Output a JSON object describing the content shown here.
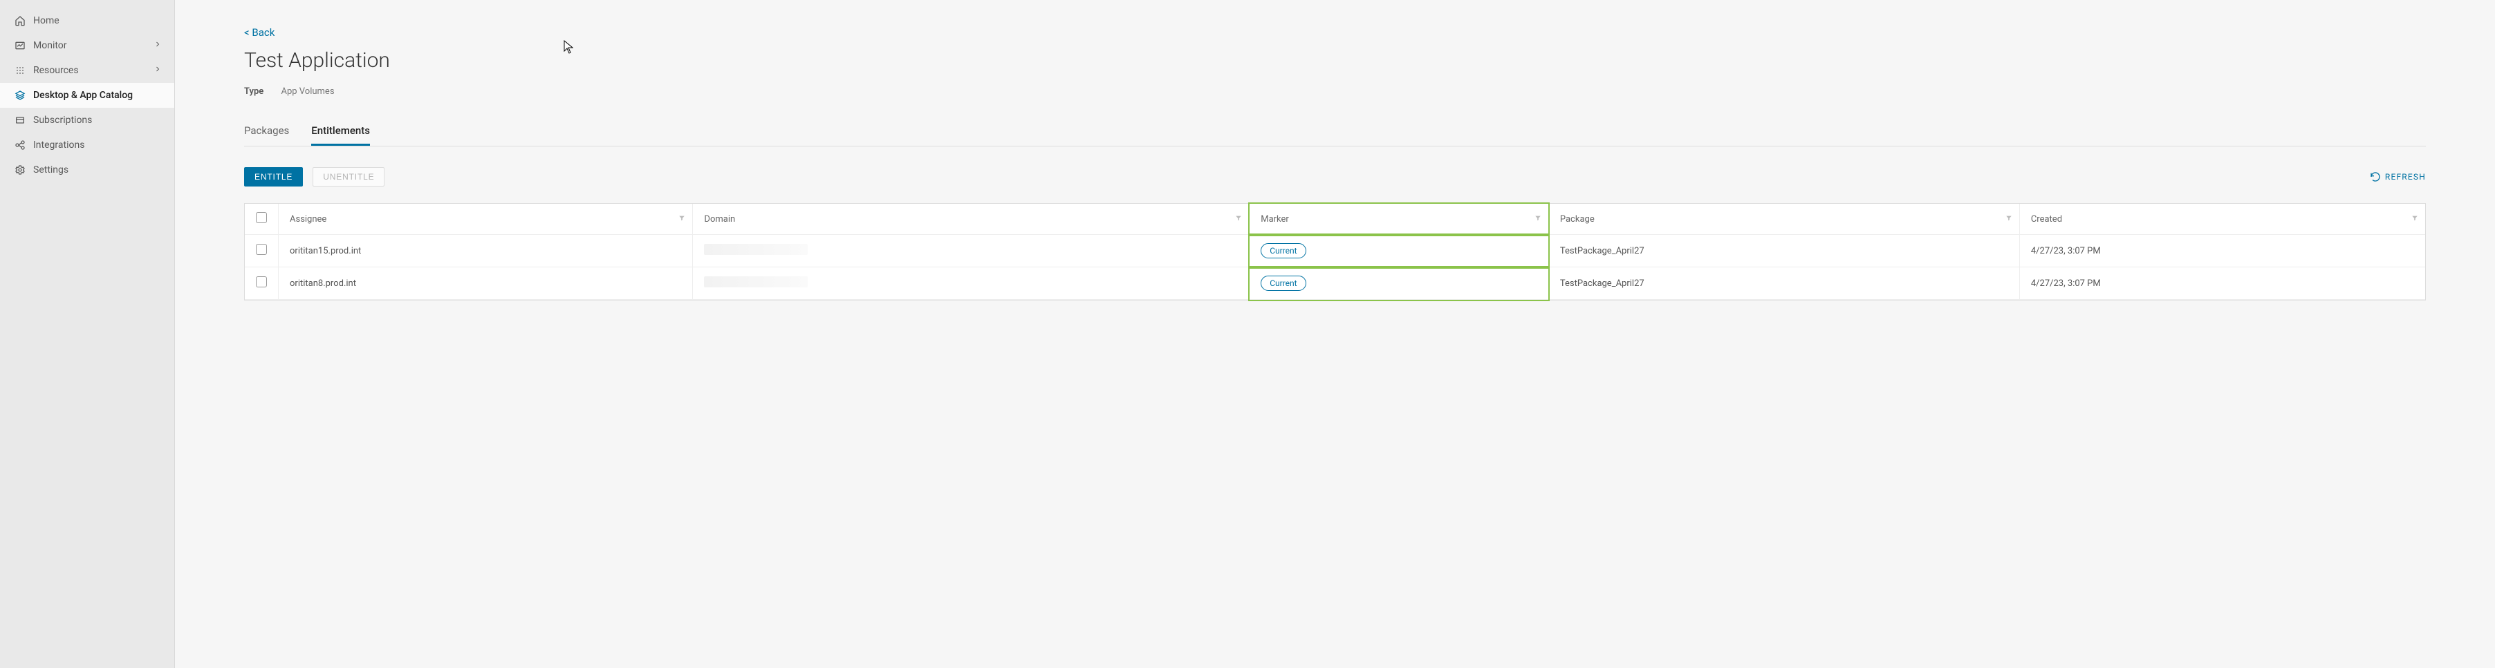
{
  "sidebar": {
    "items": [
      {
        "label": "Home"
      },
      {
        "label": "Monitor"
      },
      {
        "label": "Resources"
      },
      {
        "label": "Desktop & App Catalog"
      },
      {
        "label": "Subscriptions"
      },
      {
        "label": "Integrations"
      },
      {
        "label": "Settings"
      }
    ]
  },
  "nav": {
    "back": "< Back"
  },
  "page": {
    "title": "Test Application"
  },
  "meta": {
    "type_label": "Type",
    "type_value": "App Volumes"
  },
  "tabs": {
    "packages": "Packages",
    "entitlements": "Entitlements"
  },
  "toolbar": {
    "entitle": "ENTITLE",
    "unentitle": "UNENTITLE",
    "refresh": "REFRESH"
  },
  "table": {
    "headers": {
      "assignee": "Assignee",
      "domain": "Domain",
      "marker": "Marker",
      "package": "Package",
      "created": "Created"
    },
    "rows": [
      {
        "assignee": "orititan15.prod.int",
        "domain": "",
        "marker": "Current",
        "package": "TestPackage_April27",
        "created": "4/27/23, 3:07 PM"
      },
      {
        "assignee": "orititan8.prod.int",
        "domain": "",
        "marker": "Current",
        "package": "TestPackage_April27",
        "created": "4/27/23, 3:07 PM"
      }
    ]
  }
}
